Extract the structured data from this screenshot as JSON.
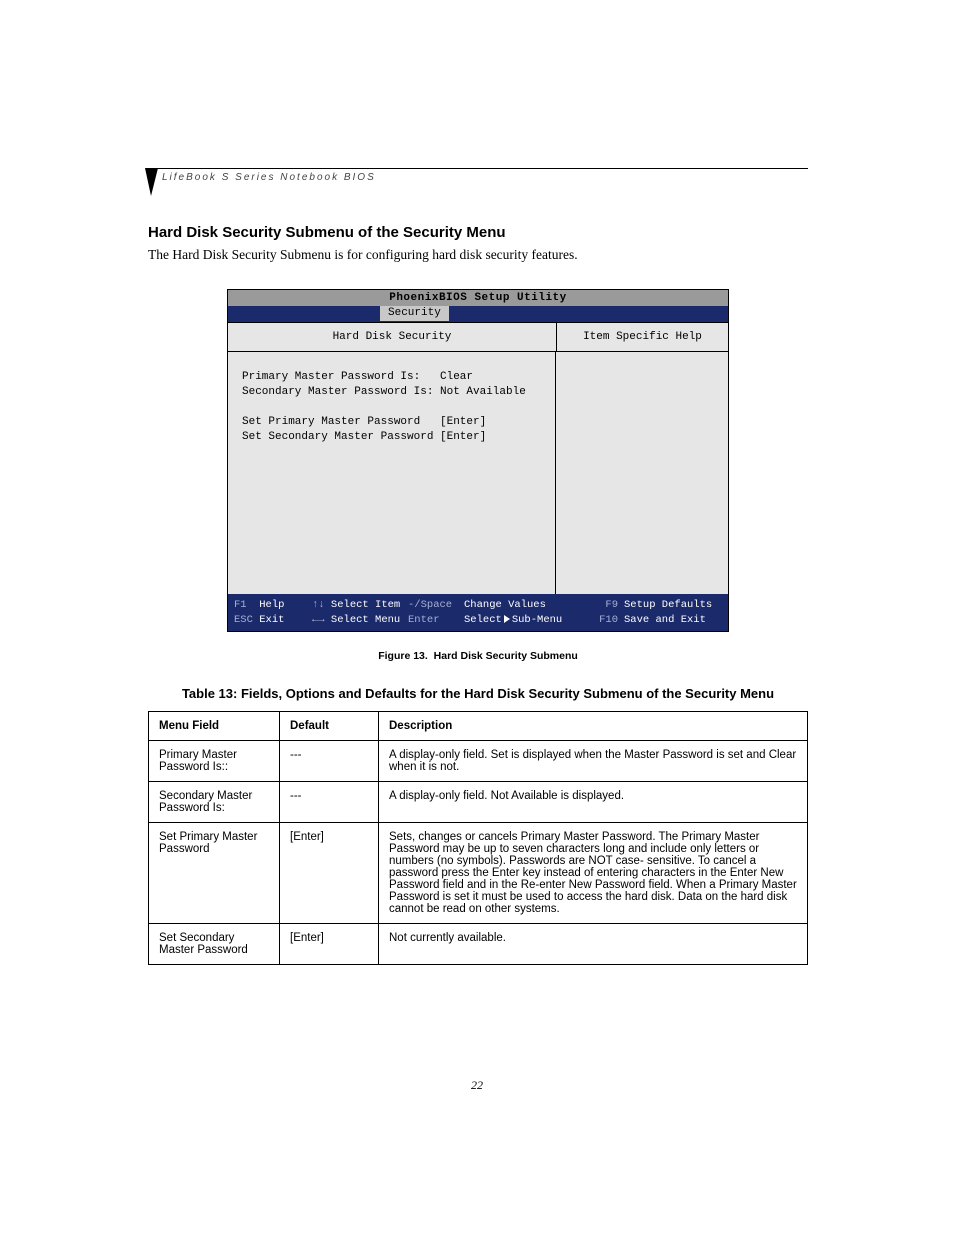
{
  "header": {
    "running_head": "LifeBook S Series Notebook BIOS"
  },
  "section": {
    "title": "Hard Disk Security Submenu of the Security Menu",
    "description": "The Hard Disk Security Submenu is for configuring hard disk security features."
  },
  "bios": {
    "title": "PhoenixBIOS Setup Utility",
    "active_tab": "Security",
    "sub_left": "Hard Disk Security",
    "sub_right": "Item Specific Help",
    "rows": [
      {
        "label": "Primary Master Password Is:",
        "value": "Clear"
      },
      {
        "label": "Secondary Master Password Is:",
        "value": "Not Available"
      }
    ],
    "rows2": [
      {
        "label": "Set Primary Master Password",
        "value": "[Enter]"
      },
      {
        "label": "Set Secondary Master Password",
        "value": "[Enter]"
      }
    ],
    "footer": {
      "line1": {
        "k1": "F1",
        "t1": "Help",
        "k2": "↑↓",
        "t2": "Select Item",
        "k3": "-/Space",
        "t3": "Change Values",
        "k4": "F9",
        "t4": "Setup Defaults"
      },
      "line2": {
        "k1": "ESC",
        "t1": "Exit",
        "k2": "←→",
        "t2": "Select Menu",
        "k3": "Enter",
        "t3a": "Select",
        "t3b": "Sub-Menu",
        "k4": "F10",
        "t4": "Save and Exit"
      }
    }
  },
  "figure": {
    "label": "Figure 13.",
    "caption": "Hard Disk Security Submenu"
  },
  "table": {
    "title": "Table 13: Fields, Options and Defaults for the Hard Disk Security Submenu of the Security Menu",
    "headers": {
      "menu": "Menu Field",
      "default": "Default",
      "desc": "Description"
    },
    "rows": [
      {
        "menu": "Primary Master Password Is::",
        "default": "---",
        "desc": "A display-only field. Set is displayed when the Master Password is set and Clear when it is not."
      },
      {
        "menu": "Secondary Master Password Is:",
        "default": "---",
        "desc": "A display-only field. Not Available is displayed."
      },
      {
        "menu": "Set Primary Master Password",
        "default": "[Enter]",
        "desc": "Sets, changes or cancels Primary Master Password. The Primary Master Password may be up to seven characters long and include only letters or numbers (no symbols). Passwords are NOT case- sensitive. To cancel a password press the Enter key instead of entering characters in the Enter New Password field and in the Re-enter New Password field. When a Primary Master Password is set it must be used to access the hard disk. Data on the hard disk cannot be read on other systems."
      },
      {
        "menu": "Set Secondary Master Password",
        "default": "[Enter]",
        "desc": "Not currently available."
      }
    ]
  },
  "page_number": "22"
}
